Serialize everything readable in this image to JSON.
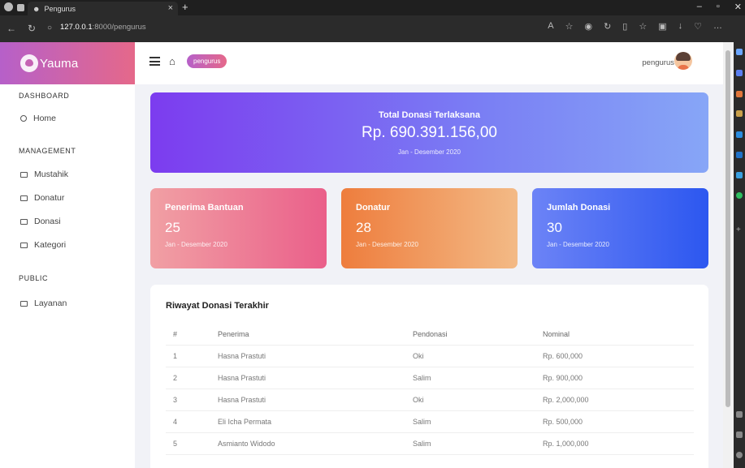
{
  "browser": {
    "tab_title": "Pengurus",
    "url_host": "127.0.0.1",
    "url_path": ":8000/pengurus",
    "url_prefix": "",
    "new_tab": "+",
    "close_tab": "×"
  },
  "brand": {
    "name": "Yauma"
  },
  "sidebar": {
    "sections": [
      {
        "heading": "DASHBOARD",
        "items": [
          {
            "label": "Home",
            "icon": "home-icon"
          }
        ]
      },
      {
        "heading": "MANAGEMENT",
        "items": [
          {
            "label": "Mustahik",
            "icon": "mail-icon"
          },
          {
            "label": "Donatur",
            "icon": "mail-icon"
          },
          {
            "label": "Donasi",
            "icon": "mail-icon"
          },
          {
            "label": "Kategori",
            "icon": "mail-icon"
          }
        ]
      },
      {
        "heading": "PUBLIC",
        "items": [
          {
            "label": "Layanan",
            "icon": "mail-icon"
          }
        ]
      }
    ]
  },
  "topbar": {
    "breadcrumb": "pengurus",
    "user": "pengurus"
  },
  "hero": {
    "title": "Total Donasi Terlaksana",
    "value": "Rp. 690.391.156,00",
    "period": "Jan - Desember 2020"
  },
  "stats": [
    {
      "title": "Penerima Bantuan",
      "value": "25",
      "period": "Jan - Desember 2020"
    },
    {
      "title": "Donatur",
      "value": "28",
      "period": "Jan - Desember 2020"
    },
    {
      "title": "Jumlah Donasi",
      "value": "30",
      "period": "Jan - Desember 2020"
    }
  ],
  "history": {
    "title": "Riwayat Donasi Terakhir",
    "headers": [
      "#",
      "Penerima",
      "Pendonasi",
      "Nominal"
    ],
    "rows": [
      [
        "1",
        "Hasna Prastuti",
        "Oki",
        "Rp. 600,000"
      ],
      [
        "2",
        "Hasna Prastuti",
        "Salim",
        "Rp. 900,000"
      ],
      [
        "3",
        "Hasna Prastuti",
        "Oki",
        "Rp. 2,000,000"
      ],
      [
        "4",
        "Eli Icha Permata",
        "Salim",
        "Rp. 500,000"
      ],
      [
        "5",
        "Asmianto Widodo",
        "Salim",
        "Rp. 1,000,000"
      ]
    ]
  },
  "colors": {
    "brand_start": "#b660c9",
    "brand_end": "#e5688a",
    "hero_start": "#7c3cef",
    "stat1": "#ea5f8a",
    "stat2": "#ee7d3d",
    "stat3": "#2c57f0"
  }
}
